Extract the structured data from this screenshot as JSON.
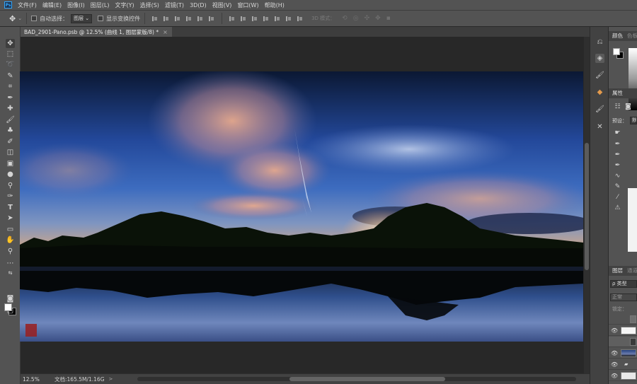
{
  "menu": {
    "logo": "Ps",
    "items": [
      "文件(F)",
      "编辑(E)",
      "图像(I)",
      "图层(L)",
      "文字(Y)",
      "选择(S)",
      "滤镜(T)",
      "3D(D)",
      "视图(V)",
      "窗口(W)",
      "帮助(H)"
    ]
  },
  "options": {
    "auto_select_label": "自动选择：",
    "auto_select_value": "图层",
    "show_transform_label": "显示变换控件",
    "mode_3d_label": "3D 模式："
  },
  "document": {
    "tab_title": "BAD_2901-Pano.psb @ 12.5% (曲线 1, 图层蒙版/8) *",
    "tab_close": "×"
  },
  "status": {
    "zoom": "12.5%",
    "doc_info": "文档:165.5M/1.16G",
    "arrow": ">"
  },
  "panels": {
    "color_tab": "颜色",
    "color_tab_2": "色板",
    "properties_tab": "属性",
    "preset_label": "预设：",
    "preset_value": "默认",
    "layers_tab": "图层",
    "layers_tab_2": "通道",
    "filter_kind": "ρ 类型",
    "blend_mode": "正常",
    "lock_label": "锁定：",
    "eye": "👁"
  },
  "colors": {
    "accent": "#31a8ff",
    "sky_top": "#0a1630",
    "sky_mid": "#2a55a8",
    "horizon": "#c88c70",
    "water": "#1a2a4a"
  }
}
